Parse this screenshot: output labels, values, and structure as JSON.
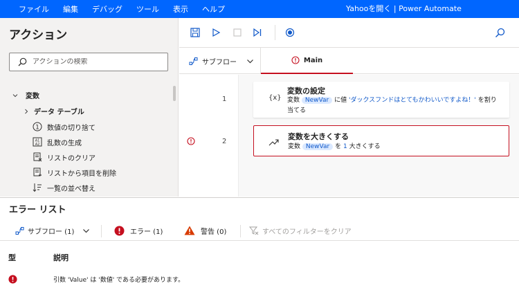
{
  "menu": [
    "ファイル",
    "編集",
    "デバッグ",
    "ツール",
    "表示",
    "ヘルプ"
  ],
  "window_title": "Yahooを開く | Power Automate",
  "left_panel": {
    "title": "アクション",
    "search_placeholder": "アクションの検索",
    "tree": {
      "group_label": "変数",
      "subgroup_label": "データ テーブル",
      "items": [
        {
          "label": "数値の切り捨て",
          "icon": "circled-one-icon"
        },
        {
          "label": "乱数の生成",
          "icon": "random-number-icon"
        },
        {
          "label": "リストのクリア",
          "icon": "clear-list-icon"
        },
        {
          "label": "リストから項目を削除",
          "icon": "remove-item-icon"
        },
        {
          "label": "一覧の並べ替え",
          "icon": "sort-list-icon"
        }
      ]
    }
  },
  "tabs": {
    "subflow_label": "サブフロー",
    "main_label": "Main"
  },
  "steps": [
    {
      "line": "1",
      "icon_text": "{x}",
      "title": "変数の設定",
      "desc_prefix": "変数",
      "var": "NewVar",
      "desc_mid": "に値",
      "value": "'ダックスフンドはとてもかわいいですよね！'",
      "desc_suffix": "を割り当てる"
    },
    {
      "line": "2",
      "title": "変数を大きくする",
      "desc_prefix": "変数",
      "var": "NewVar",
      "desc_mid": "を",
      "amount": "1",
      "desc_suffix": "大きくする"
    }
  ],
  "error_list": {
    "title": "エラー リスト",
    "subflow_filter": "サブフロー (1)",
    "errors_filter": "エラー (1)",
    "warnings_filter": "警告 (0)",
    "clear_filters": "すべてのフィルターをクリア",
    "col_type": "型",
    "col_desc": "説明",
    "rows": [
      {
        "message": "引数 'Value' は '数値' である必要があります。"
      }
    ]
  },
  "colors": {
    "titlebar": "#0066ff",
    "accent_blue": "#0f58c9",
    "error_red": "#c50f1f",
    "warning_orange": "#d83b01"
  }
}
